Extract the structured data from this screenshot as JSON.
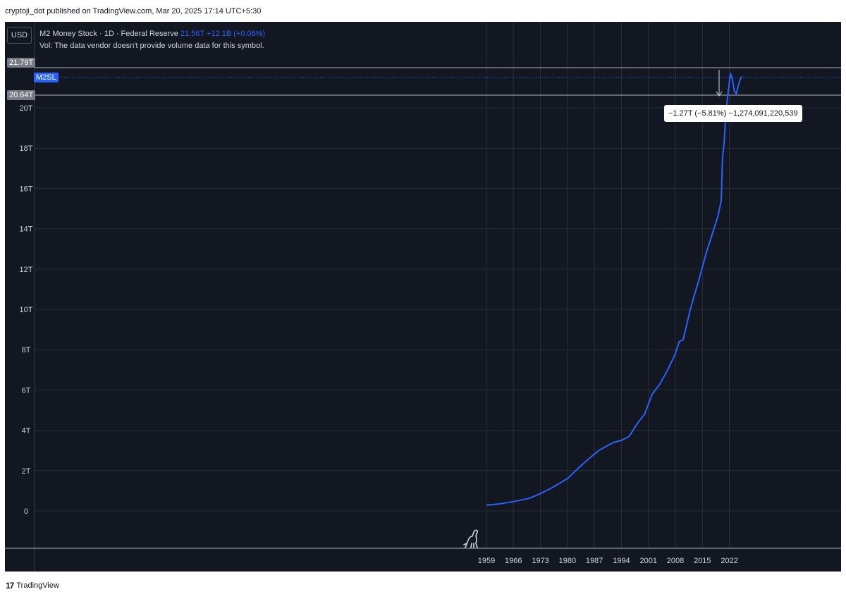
{
  "header": {
    "published_line": "cryptoji_dot published on TradingView.com, Mar 20, 2025 17:14 UTC+5:30"
  },
  "toolbar": {
    "currency": "USD"
  },
  "legend": {
    "symbol_line": "M2 Money Stock · 1D · Federal Reserve",
    "last_value": "21.56T",
    "change": "+12.1B (+0.06%)",
    "volume_note": "Vol: The data vendor doesn't provide volume data for this symbol."
  },
  "price_tags": {
    "upper": "21.79T",
    "symbol": "M2SL",
    "lower": "20.64T"
  },
  "measure": {
    "text": "−1.27T (−5.81%) −1,274,091,220,539"
  },
  "footer": {
    "brand": "TradingView",
    "logo_mark": "17"
  },
  "colors": {
    "background": "#131722",
    "line": "#2962ff",
    "grid": "#2a2e39",
    "text": "#d1d4dc",
    "tag_gray": "#787b86",
    "tag_blue": "#2962ff"
  },
  "chart_data": {
    "type": "line",
    "title": "M2 Money Stock · 1D · Federal Reserve",
    "xlabel": "",
    "ylabel": "",
    "ylim": [
      -1.8,
      22.5
    ],
    "xlim": [
      1942.1,
      2063.3
    ],
    "grid": true,
    "y_ticks": [
      0,
      2,
      4,
      6,
      8,
      10,
      12,
      14,
      16,
      18,
      20
    ],
    "y_tick_labels": [
      "0",
      "2T",
      "4T",
      "6T",
      "8T",
      "10T",
      "12T",
      "14T",
      "16T",
      "18T",
      "20T"
    ],
    "x_ticks": [
      1959,
      1966,
      1973,
      1980,
      1987,
      1994,
      2001,
      2008,
      2015,
      2022
    ],
    "x_tick_labels": [
      "1959",
      "1966",
      "1973",
      "1980",
      "1987",
      "1994",
      "2001",
      "2008",
      "2015",
      "2022"
    ],
    "series": [
      {
        "name": "M2SL",
        "unit": "T",
        "x": [
          1959,
          1962,
          1966,
          1970,
          1973,
          1976,
          1980,
          1983,
          1985,
          1988,
          1990,
          1992,
          1994,
          1996,
          1998,
          2000,
          2002,
          2004,
          2006,
          2008,
          2009,
          2010,
          2012,
          2014,
          2016,
          2018,
          2019,
          2019.9,
          2020.2,
          2020.6,
          2021.0,
          2021.5,
          2022.0,
          2022.3,
          2022.8,
          2023.3,
          2023.8,
          2024.3,
          2024.8,
          2025.2
        ],
        "y": [
          0.29,
          0.34,
          0.46,
          0.62,
          0.86,
          1.15,
          1.6,
          2.15,
          2.5,
          2.98,
          3.2,
          3.4,
          3.5,
          3.7,
          4.3,
          4.8,
          5.8,
          6.3,
          7.0,
          7.8,
          8.4,
          8.5,
          10.1,
          11.4,
          12.8,
          14.0,
          14.6,
          15.4,
          17.5,
          18.2,
          19.4,
          20.5,
          21.3,
          21.7,
          21.4,
          20.8,
          20.7,
          21.1,
          21.4,
          21.56
        ]
      }
    ]
  }
}
